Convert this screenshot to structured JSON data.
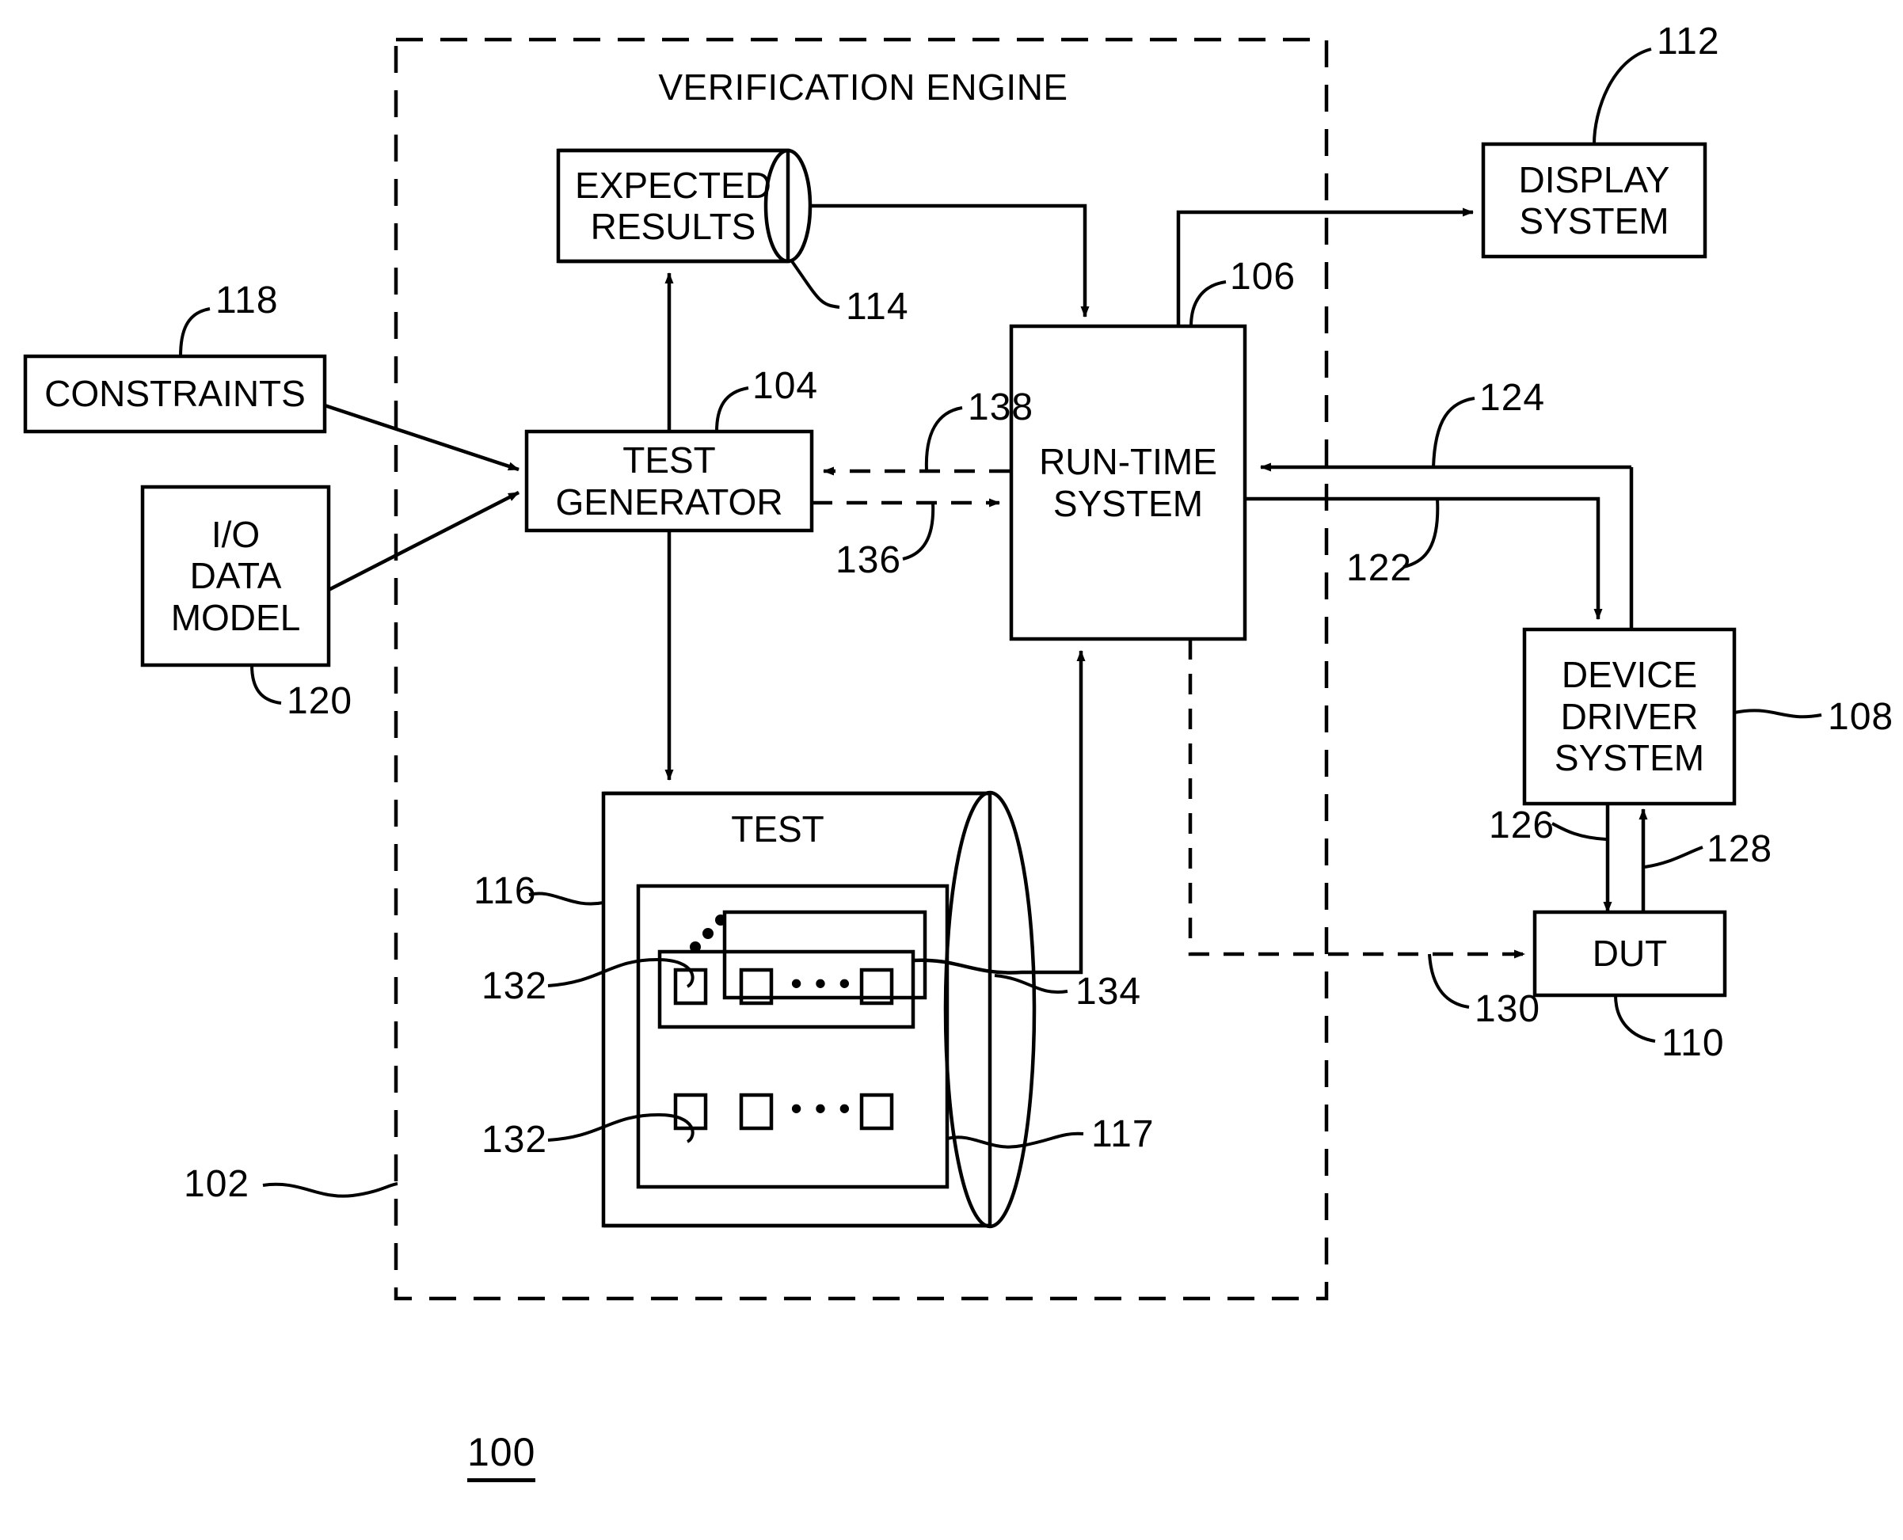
{
  "figure": {
    "number": "100",
    "title": "VERIFICATION ENGINE"
  },
  "blocks": {
    "verification_engine": {
      "label": "VERIFICATION ENGINE",
      "ref": "102"
    },
    "expected_results": {
      "label": "EXPECTED\nRESULTS",
      "ref": "114"
    },
    "constraints": {
      "label": "CONSTRAINTS",
      "ref": "118"
    },
    "io_data_model": {
      "label": "I/O\nDATA\nMODEL",
      "ref": "120"
    },
    "test_generator": {
      "label": "TEST\nGENERATOR",
      "ref": "104"
    },
    "run_time_system": {
      "label": "RUN-TIME\nSYSTEM",
      "ref": "106"
    },
    "display_system": {
      "label": "DISPLAY\nSYSTEM",
      "ref": "112"
    },
    "device_driver_system": {
      "label": "DEVICE\nDRIVER\nSYSTEM",
      "ref": "108"
    },
    "dut": {
      "label": "DUT",
      "ref": "110"
    },
    "test_store": {
      "label": "TEST",
      "ref": "116",
      "inner_ref": "117"
    }
  },
  "refs": {
    "r100": "100",
    "r102": "102",
    "r104": "104",
    "r106": "106",
    "r108": "108",
    "r110": "110",
    "r112": "112",
    "r114": "114",
    "r116": "116",
    "r117": "117",
    "r118": "118",
    "r120": "120",
    "r122": "122",
    "r124": "124",
    "r126": "126",
    "r128": "128",
    "r130": "130",
    "r132_upper": "132",
    "r132_lower": "132",
    "r134": "134",
    "r136": "136",
    "r138": "138"
  },
  "ellipsis": {
    "row_upper": "• • •",
    "row_lower": "• • •"
  },
  "colors": {
    "line": "#000000",
    "background": "#ffffff"
  }
}
